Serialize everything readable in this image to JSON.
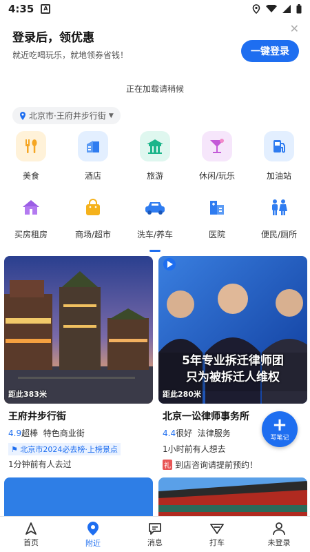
{
  "status_bar": {
    "time": "4:35",
    "notif": "A"
  },
  "login_banner": {
    "title": "登录后，领优惠",
    "subtitle": "就近吃喝玩乐，就地领券省钱！",
    "button": "一键登录"
  },
  "loading_text": "正在加载请稍候",
  "location": "北京市·王府井步行街",
  "categories": [
    {
      "label": "美食",
      "icon": "food-icon",
      "bg": "#fff2d9"
    },
    {
      "label": "酒店",
      "icon": "hotel-icon",
      "bg": "#e3efff"
    },
    {
      "label": "旅游",
      "icon": "travel-icon",
      "bg": "#dff7ef"
    },
    {
      "label": "休闲/玩乐",
      "icon": "leisure-icon",
      "bg": "#f6e6fb"
    },
    {
      "label": "加油站",
      "icon": "gas-station-icon",
      "bg": "#e3efff"
    },
    {
      "label": "买房租房",
      "icon": "house-icon"
    },
    {
      "label": "商场/超市",
      "icon": "shopping-bag-icon"
    },
    {
      "label": "洗车/养车",
      "icon": "car-icon"
    },
    {
      "label": "医院",
      "icon": "hospital-icon"
    },
    {
      "label": "便民/厕所",
      "icon": "restroom-icon"
    }
  ],
  "cards": [
    {
      "distance": "距此383米",
      "name": "王府井步行街",
      "score": "4.9",
      "rating": "超棒",
      "type": "特色商业街",
      "tag": "北京市2024必去榜·上榜景点",
      "recent": "1分钟前有人去过"
    },
    {
      "distance": "距此280米",
      "name": "北京一讼律师事务所",
      "score": "4.4",
      "rating": "很好",
      "type": "法律服务",
      "recent": "1小时前有人想去",
      "gift": "礼",
      "promo": "到店咨询请提前预约！",
      "banner_line1": "5年专业拆迁律师团",
      "banner_line2": "只为被拆迁人维权"
    }
  ],
  "fab_label": "写笔记",
  "tabs": [
    {
      "label": "首页",
      "icon": "home-icon"
    },
    {
      "label": "附近",
      "icon": "nearby-icon"
    },
    {
      "label": "消息",
      "icon": "message-icon"
    },
    {
      "label": "打车",
      "icon": "taxi-icon"
    },
    {
      "label": "未登录",
      "icon": "user-icon"
    }
  ],
  "colors": {
    "accent": "#1e6ef0"
  }
}
